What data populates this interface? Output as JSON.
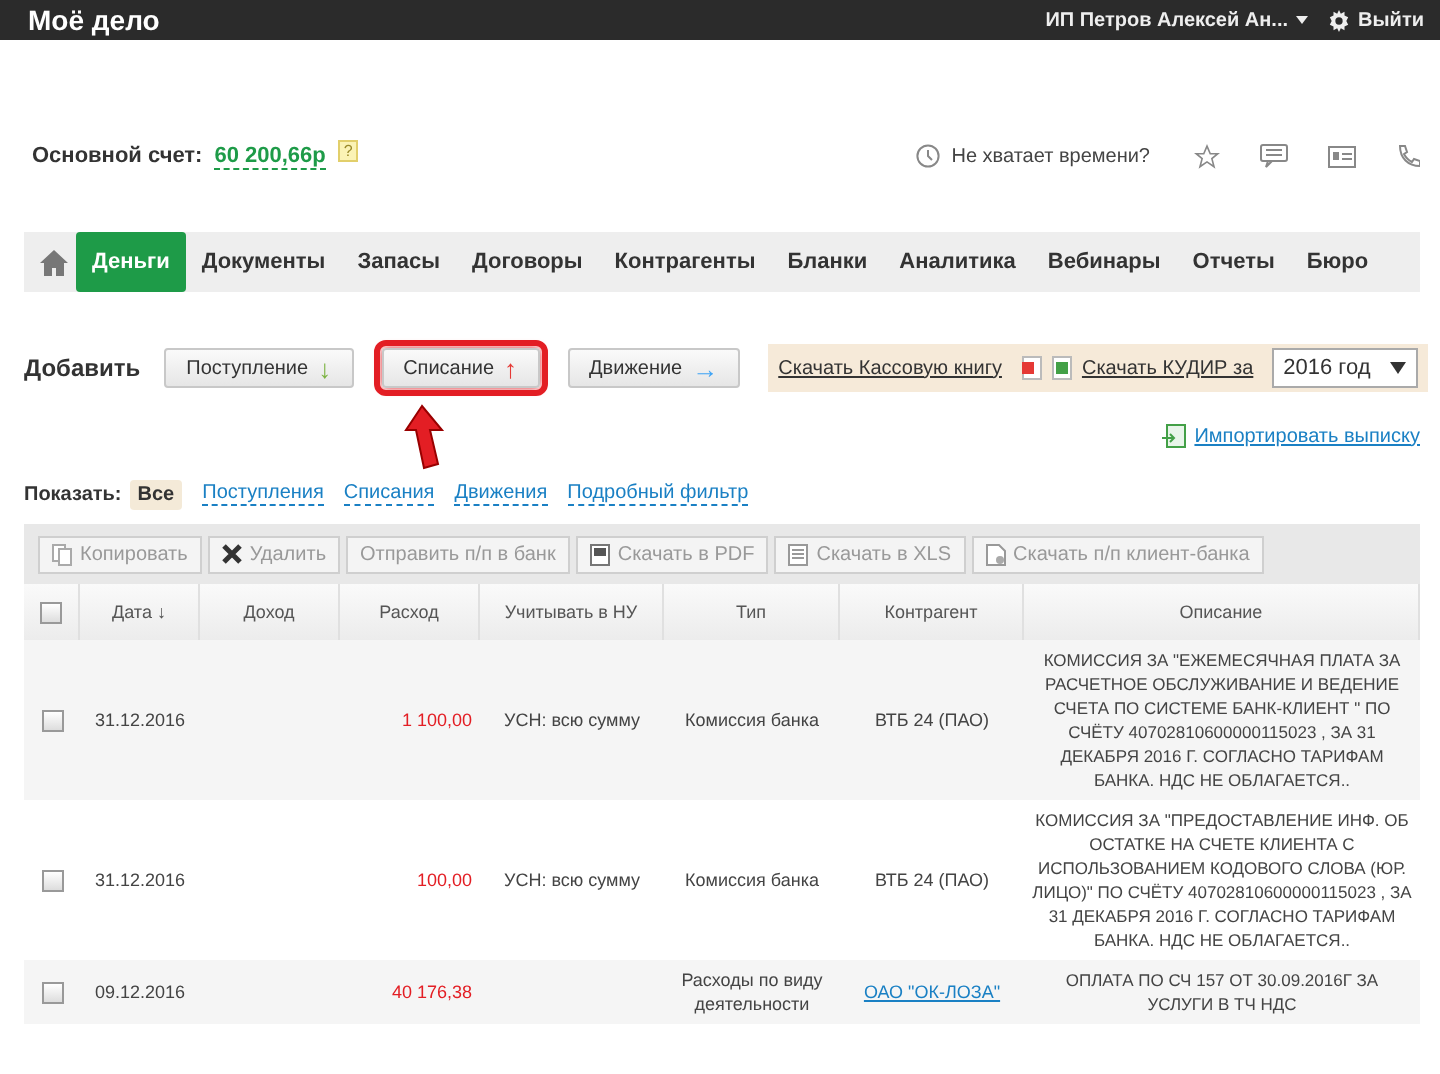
{
  "topbar": {
    "logo": "Моё дело",
    "user": "ИП Петров Алексей Ан...",
    "logout": "Выйти"
  },
  "account": {
    "label": "Основной счет:",
    "amount": "60 200,66р",
    "help": "?",
    "promo": "Не хватает времени?"
  },
  "nav": [
    {
      "label": "Деньги",
      "selected": true
    },
    {
      "label": "Документы",
      "selected": false
    },
    {
      "label": "Запасы",
      "selected": false
    },
    {
      "label": "Договоры",
      "selected": false
    },
    {
      "label": "Контрагенты",
      "selected": false
    },
    {
      "label": "Бланки",
      "selected": false
    },
    {
      "label": "Аналитика",
      "selected": false
    },
    {
      "label": "Вебинары",
      "selected": false
    },
    {
      "label": "Отчеты",
      "selected": false
    },
    {
      "label": "Бюро",
      "selected": false
    }
  ],
  "add": {
    "label": "Добавить",
    "buttons": [
      {
        "label": "Поступление",
        "arrow": "↓",
        "kind": "in",
        "highlighted": false
      },
      {
        "label": "Списание",
        "arrow": "↑",
        "kind": "out",
        "highlighted": true
      },
      {
        "label": "Движение",
        "arrow": "→",
        "kind": "move",
        "highlighted": false
      }
    ]
  },
  "cashbook": "Скачать Кассовую книгу",
  "kudir": {
    "label": "Скачать КУДИР за",
    "year": "2016 год"
  },
  "import": "Импортировать выписку",
  "filter": {
    "label": "Показать:",
    "items": [
      {
        "label": "Все",
        "selected": true
      },
      {
        "label": "Поступления",
        "selected": false
      },
      {
        "label": "Списания",
        "selected": false
      },
      {
        "label": "Движения",
        "selected": false
      },
      {
        "label": "Подробный фильтр",
        "selected": false
      }
    ]
  },
  "toolbar": [
    {
      "label": "Копировать",
      "kind": "copy"
    },
    {
      "label": "Удалить",
      "kind": "delete"
    },
    {
      "label": "Отправить п/п в банк",
      "kind": "plain"
    },
    {
      "label": "Скачать в PDF",
      "kind": "pdf"
    },
    {
      "label": "Скачать в XLS",
      "kind": "xls"
    },
    {
      "label": "Скачать п/п клиент-банка",
      "kind": "file"
    }
  ],
  "table": {
    "all_checked": false,
    "columns": [
      "Дата ↓",
      "Доход",
      "Расход",
      "Учитывать в НУ",
      "Тип",
      "Контрагент",
      "Описание"
    ],
    "rows": [
      {
        "checked": false,
        "date": "31.12.2016",
        "income": "",
        "expense": "1 100,00",
        "nu": "УСН: всю сумму",
        "type": "Комиссия банка",
        "counterparty": "ВТБ 24 (ПАО)",
        "counterparty_link": false,
        "description": "КОМИССИЯ ЗА \"ЕЖЕМЕСЯЧНАЯ ПЛАТА ЗА РАСЧЕТНОЕ ОБСЛУЖИВАНИЕ И ВЕДЕНИЕ СЧЕТА ПО СИСТЕМЕ БАНК-КЛИЕНТ \" ПО СЧЁТУ 40702810600000115023 , ЗА 31 ДЕКАБРЯ 2016 Г. СОГЛАСНО ТАРИФАМ БАНКА. НДС НЕ ОБЛАГАЕТСЯ.."
      },
      {
        "checked": false,
        "date": "31.12.2016",
        "income": "",
        "expense": "100,00",
        "nu": "УСН: всю сумму",
        "type": "Комиссия банка",
        "counterparty": "ВТБ 24 (ПАО)",
        "counterparty_link": false,
        "description": "КОМИССИЯ ЗА \"ПРЕДОСТАВЛЕНИЕ ИНФ. ОБ ОСТАТКЕ НА СЧЕТЕ КЛИЕНТА С ИСПОЛЬЗОВАНИЕМ КОДОВОГО СЛОВА (ЮР. ЛИЦО)\" ПО СЧЁТУ 40702810600000115023 , ЗА 31 ДЕКАБРЯ 2016 Г. СОГЛАСНО ТАРИФАМ БАНКА. НДС НЕ ОБЛАГАЕТСЯ.."
      },
      {
        "checked": false,
        "date": "09.12.2016",
        "income": "",
        "expense": "40 176,38",
        "nu": "",
        "type": "Расходы по виду деятельности",
        "counterparty": "ОАО \"ОК-ЛОЗА\"",
        "counterparty_link": true,
        "description": "ОПЛАТА ПО СЧ 157 ОТ 30.09.2016Г ЗА УСЛУГИ В ТЧ НДС"
      }
    ]
  }
}
